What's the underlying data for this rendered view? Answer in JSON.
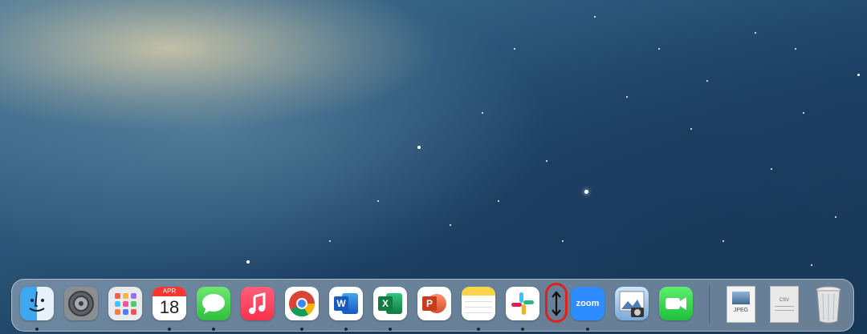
{
  "desktop": {
    "wallpaper": "galaxy-night-sky"
  },
  "dock": {
    "apps": [
      {
        "name": "Finder",
        "icon": "finder-icon",
        "running": true
      },
      {
        "name": "System Settings",
        "icon": "gear-icon",
        "running": false
      },
      {
        "name": "Launchpad",
        "icon": "launchpad-icon",
        "running": false
      },
      {
        "name": "Calendar",
        "icon": "calendar-icon",
        "month": "APR",
        "day": "18",
        "running": true
      },
      {
        "name": "Messages",
        "icon": "messages-icon",
        "running": true
      },
      {
        "name": "Music",
        "icon": "music-icon",
        "running": false
      },
      {
        "name": "Google Chrome",
        "icon": "chrome-icon",
        "running": true
      },
      {
        "name": "Microsoft Word",
        "icon": "word-icon",
        "label": "W",
        "running": true
      },
      {
        "name": "Microsoft Excel",
        "icon": "excel-icon",
        "label": "X",
        "running": true
      },
      {
        "name": "Microsoft PowerPoint",
        "icon": "powerpoint-icon",
        "label": "P",
        "running": false
      },
      {
        "name": "Notes",
        "icon": "notes-icon",
        "running": true
      },
      {
        "name": "Slack",
        "icon": "slack-icon",
        "running": true
      },
      {
        "name": "Resize Handle",
        "icon": "resize-vertical-icon",
        "running": false
      },
      {
        "name": "Zoom",
        "icon": "zoom-icon",
        "label": "zoom",
        "running": true
      },
      {
        "name": "Preview",
        "icon": "preview-icon",
        "running": false
      },
      {
        "name": "FaceTime",
        "icon": "facetime-icon",
        "running": false
      }
    ],
    "documents": [
      {
        "name": "JPEG file",
        "icon": "jpeg-file-icon",
        "label": "JPEG"
      },
      {
        "name": "CSV file",
        "icon": "csv-file-icon",
        "label": "CSV"
      },
      {
        "name": "Trash",
        "icon": "trash-icon"
      }
    ],
    "highlight_color": "#e0201b"
  }
}
